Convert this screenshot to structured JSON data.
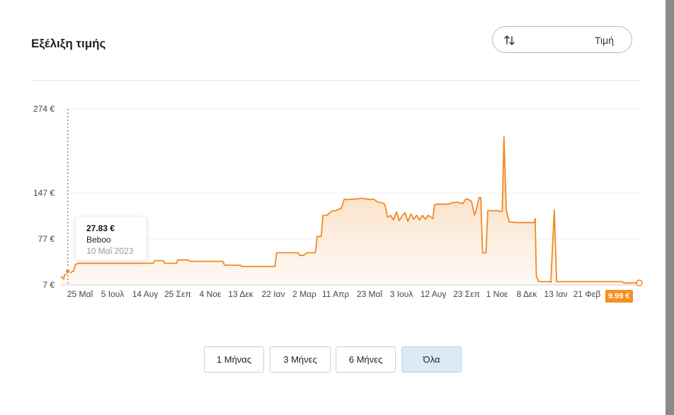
{
  "header": {
    "title": "Εξέλιξη τιμής",
    "sort_label": "Τιμή"
  },
  "tooltip": {
    "price": "27.83 €",
    "shop": "Beboo",
    "date": "10 Μαΐ 2023"
  },
  "last_price_badge": "9.99 €",
  "range_buttons": {
    "one_month": "1 Μήνας",
    "three_months": "3 Μήνες",
    "six_months": "6 Μήνες",
    "all": "Όλα"
  },
  "colors": {
    "line": "#f08a24",
    "fill_top": "#f6c08a",
    "badge": "#f59020",
    "active_button": "#dce9f7"
  },
  "chart_data": {
    "type": "area",
    "ylim": [
      7,
      274
    ],
    "y_ticks": [
      {
        "value": 7,
        "label": "7 €"
      },
      {
        "value": 77,
        "label": "77 €"
      },
      {
        "value": 147,
        "label": "147 €"
      },
      {
        "value": 274,
        "label": "274 €"
      }
    ],
    "x_ticks": [
      "25 Μαΐ",
      "5 Ιουλ",
      "14 Αυγ",
      "25 Σεπ",
      "4 Νοε",
      "13 Δεκ",
      "22 Ιαν",
      "2 Μαρ",
      "11 Απρ",
      "23 Μαΐ",
      "3 Ιουλ",
      "12 Αυγ",
      "23 Σεπ",
      "1 Νοε",
      "8 Δεκ",
      "13 Ιαν",
      "21 Φεβ"
    ],
    "xlim": [
      0,
      100
    ],
    "series": [
      {
        "values_xy": [
          [
            0,
            20
          ],
          [
            0.5,
            16
          ],
          [
            0.6,
            22
          ],
          [
            1.2,
            25
          ],
          [
            1.6,
            25
          ],
          [
            2.1,
            28
          ],
          [
            2.2,
            28
          ],
          [
            2.5,
            38
          ],
          [
            3,
            40
          ],
          [
            16,
            40
          ],
          [
            16.2,
            44
          ],
          [
            17.8,
            44
          ],
          [
            17.9,
            40
          ],
          [
            20,
            40
          ],
          [
            20.2,
            45
          ],
          [
            22,
            45
          ],
          [
            22.3,
            43
          ],
          [
            28,
            43
          ],
          [
            28.3,
            37
          ],
          [
            31,
            37
          ],
          [
            31.3,
            35
          ],
          [
            37,
            35
          ],
          [
            37.3,
            56
          ],
          [
            41,
            56
          ],
          [
            41.3,
            52
          ],
          [
            42,
            52
          ],
          [
            42.5,
            56
          ],
          [
            44,
            56
          ],
          [
            44.3,
            81
          ],
          [
            45,
            81
          ],
          [
            45.3,
            113
          ],
          [
            46,
            113
          ],
          [
            46.5,
            117
          ],
          [
            47,
            120
          ],
          [
            47.5,
            120
          ],
          [
            48.5,
            124
          ],
          [
            49,
            138
          ],
          [
            49.5,
            137
          ],
          [
            51,
            138
          ],
          [
            52,
            139
          ],
          [
            53.5,
            137
          ],
          [
            54,
            138
          ],
          [
            54.8,
            133
          ],
          [
            55.5,
            132
          ],
          [
            56,
            130
          ],
          [
            56.5,
            110
          ],
          [
            57,
            113
          ],
          [
            57.5,
            106
          ],
          [
            58,
            118
          ],
          [
            58.5,
            105
          ],
          [
            59,
            112
          ],
          [
            59.5,
            117
          ],
          [
            60,
            104
          ],
          [
            60.5,
            115
          ],
          [
            61,
            107
          ],
          [
            61.5,
            113
          ],
          [
            62,
            106
          ],
          [
            62.5,
            113
          ],
          [
            63,
            107
          ],
          [
            63.5,
            113
          ],
          [
            64.3,
            108
          ],
          [
            64.6,
            129
          ],
          [
            65,
            130
          ],
          [
            67,
            130
          ],
          [
            67.5,
            132
          ],
          [
            68.5,
            133
          ],
          [
            69.5,
            131
          ],
          [
            70,
            138
          ],
          [
            70.5,
            137
          ],
          [
            71,
            134
          ],
          [
            71.5,
            113
          ],
          [
            71.8,
            121
          ],
          [
            72.3,
            140
          ],
          [
            72.6,
            140
          ],
          [
            72.9,
            56
          ],
          [
            73.5,
            56
          ],
          [
            73.8,
            120
          ],
          [
            75.5,
            120
          ],
          [
            76,
            119
          ],
          [
            76.3,
            119
          ],
          [
            76.6,
            232
          ],
          [
            77,
            121
          ],
          [
            77.5,
            103
          ],
          [
            79,
            102
          ],
          [
            81,
            102
          ],
          [
            81.8,
            102
          ],
          [
            82,
            108
          ],
          [
            82.2,
            20
          ],
          [
            82.6,
            12
          ],
          [
            84.5,
            12
          ],
          [
            84.7,
            11
          ],
          [
            85.3,
            121
          ],
          [
            85.7,
            12
          ],
          [
            97,
            12
          ],
          [
            97.3,
            10
          ],
          [
            100,
            10
          ]
        ]
      }
    ],
    "highlight": {
      "x": 1.2,
      "value": 27.83,
      "label": "27.83 €"
    },
    "last_point": {
      "x": 100,
      "value": 9.99
    }
  }
}
